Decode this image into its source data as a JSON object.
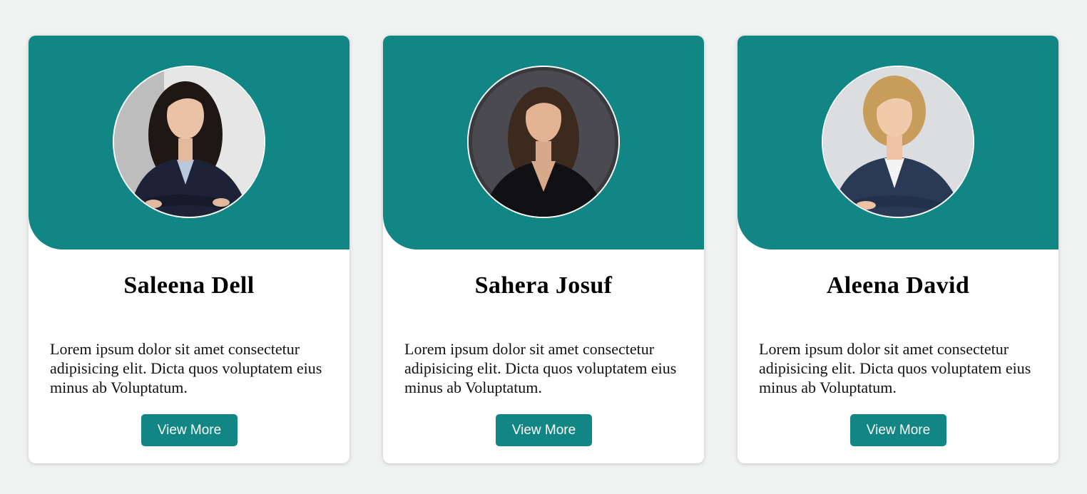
{
  "profiles": [
    {
      "name": "Saleena Dell",
      "description": "Lorem ipsum dolor sit amet consectetur adipisicing elit. Dicta quos voluptatem eius minus ab Voluptatum.",
      "button_label": "View More"
    },
    {
      "name": "Sahera Josuf",
      "description": "Lorem ipsum dolor sit amet consectetur adipisicing elit. Dicta quos voluptatem eius minus ab Voluptatum.",
      "button_label": "View More"
    },
    {
      "name": "Aleena David",
      "description": "Lorem ipsum dolor sit amet consectetur adipisicing elit. Dicta quos voluptatem eius minus ab Voluptatum.",
      "button_label": "View More"
    }
  ],
  "colors": {
    "accent": "#128585",
    "page_background": "#f0f2f2",
    "card_background": "#ffffff"
  }
}
